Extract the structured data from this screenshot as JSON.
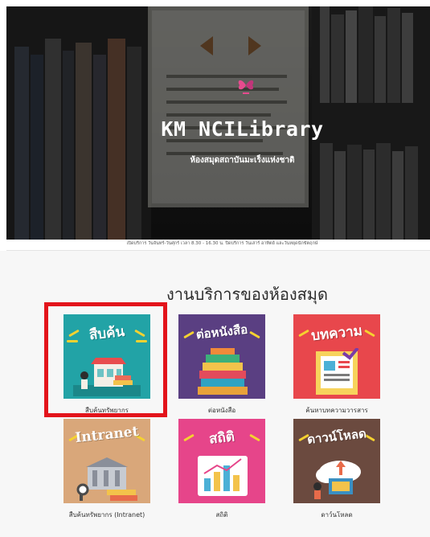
{
  "hero": {
    "title": "KM NCILibrary",
    "subtitle": "ห้องสมุดสถาบันมะเร็งแห่งชาติ",
    "logo_icon": "butterfly-logo-icon"
  },
  "opening_hours": "เปิดบริการ วันจันทร์-วันศุกร์ เวลา 8.30 - 16.30 น. ปิดบริการ วันเสาร์ อาทิตย์ และวันหยุดนักขัตฤกษ์",
  "services": {
    "title": "งานบริการของห้องสมุด",
    "items": [
      {
        "tile_text": "สืบค้น",
        "label": "สืบค้นทรัพยากร",
        "color": "#22a3a6",
        "icon": "search-library-icon"
      },
      {
        "tile_text": "ต่อหนังสือ",
        "label": "ต่อหนังสือ",
        "color": "#5a3f82",
        "icon": "book-stack-icon"
      },
      {
        "tile_text": "บทความ",
        "label": "ค้นหาบทความวารสาร",
        "color": "#e8474c",
        "icon": "article-icon"
      },
      {
        "tile_text": "Intranet",
        "label": "สืบค้นทรัพยากร (Intranet)",
        "color": "#d9a77a",
        "icon": "intranet-library-icon"
      },
      {
        "tile_text": "สถิติ",
        "label": "สถิติ",
        "color": "#e6458a",
        "icon": "statistics-icon"
      },
      {
        "tile_text": "ดาวน์โหลด",
        "label": "ดาว์นโหลด",
        "color": "#6b4a3f",
        "icon": "download-icon"
      }
    ]
  },
  "highlight_color": "#e3141b"
}
